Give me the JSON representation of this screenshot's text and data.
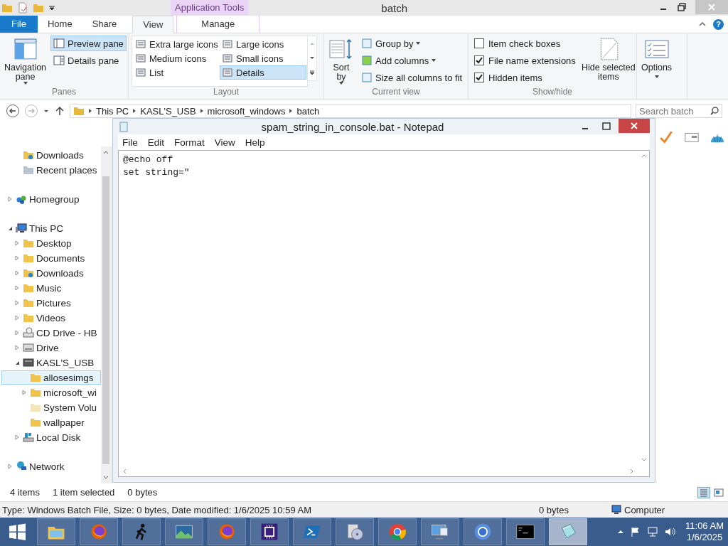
{
  "titlebar": {
    "title": "batch",
    "context_group": "Application Tools",
    "help": "?"
  },
  "ribbon_tabs": [
    {
      "label": "File",
      "kind": "file",
      "selected": false
    },
    {
      "label": "Home",
      "kind": "tab",
      "selected": false
    },
    {
      "label": "Share",
      "kind": "tab",
      "selected": false
    },
    {
      "label": "View",
      "kind": "tab",
      "selected": true
    },
    {
      "label": "Manage",
      "kind": "context",
      "selected": false
    }
  ],
  "ribbon": {
    "panes": {
      "title": "Panes",
      "navigation_pane": "Navigation pane",
      "items": [
        {
          "label": "Preview pane",
          "selected": true
        },
        {
          "label": "Details pane",
          "selected": false
        }
      ]
    },
    "layout": {
      "title": "Layout",
      "items": [
        {
          "label": "Extra large icons",
          "selected": false
        },
        {
          "label": "Large icons",
          "selected": false
        },
        {
          "label": "Medium icons",
          "selected": false
        },
        {
          "label": "Small icons",
          "selected": false
        },
        {
          "label": "List",
          "selected": false
        },
        {
          "label": "Details",
          "selected": true
        }
      ]
    },
    "current_view": {
      "title": "Current view",
      "sort_by": "Sort by",
      "items": [
        "Group by",
        "Add columns",
        "Size all columns to fit"
      ]
    },
    "show_hide": {
      "title": "Show/hide",
      "checkboxes": [
        {
          "label": "Item check boxes",
          "checked": false
        },
        {
          "label": "File name extensions",
          "checked": true
        },
        {
          "label": "Hidden items",
          "checked": true
        }
      ],
      "hide_selected": "Hide selected items"
    },
    "options": "Options"
  },
  "address_bar": {
    "breadcrumb": [
      "This PC",
      "KASL'S_USB",
      "microsoft_windows",
      "batch"
    ],
    "search": {
      "placeholder": "Search batch"
    }
  },
  "favorites": [
    {
      "label": "Downloads",
      "kind": "downloads",
      "selected": false
    },
    {
      "label": "Recent places",
      "kind": "recent",
      "selected": false
    }
  ],
  "tree": [
    {
      "label": "Homegroup",
      "kind": "homegroup",
      "expanded": false,
      "selected": false
    },
    {
      "label": "This PC",
      "kind": "pc",
      "expanded": true,
      "selected": false,
      "children": [
        {
          "label": "Desktop",
          "kind": "folder",
          "expanded": false,
          "selected": false
        },
        {
          "label": "Documents",
          "kind": "folder",
          "expanded": false,
          "selected": false
        },
        {
          "label": "Downloads",
          "kind": "downloads",
          "expanded": false,
          "selected": false
        },
        {
          "label": "Music",
          "kind": "folder",
          "expanded": false,
          "selected": false
        },
        {
          "label": "Pictures",
          "kind": "folder",
          "expanded": false,
          "selected": false
        },
        {
          "label": "Videos",
          "kind": "folder",
          "expanded": false,
          "selected": false
        },
        {
          "label": "CD Drive - HB",
          "kind": "cd",
          "expanded": false,
          "selected": false
        },
        {
          "label": "Drive",
          "kind": "drive",
          "expanded": false,
          "selected": false
        },
        {
          "label": "KASL'S_USB",
          "kind": "usb",
          "expanded": true,
          "selected": false,
          "children": [
            {
              "label": "allosesimgs",
              "kind": "folder",
              "selected": true
            },
            {
              "label": "microsoft_wi",
              "kind": "folder",
              "expanded": false,
              "selected": false
            },
            {
              "label": "System Volu",
              "kind": "faded",
              "selected": false
            },
            {
              "label": "wallpaper",
              "kind": "folder",
              "selected": false
            }
          ]
        },
        {
          "label": "Local Disk",
          "kind": "disk",
          "expanded": false,
          "selected": false
        }
      ]
    },
    {
      "label": "Network",
      "kind": "network",
      "expanded": false,
      "selected": false
    }
  ],
  "status_bar": {
    "item_count": "4 items",
    "selection": "1 item selected",
    "size": "0 bytes"
  },
  "details_bar": {
    "info": "Type: Windows Batch File, Size: 0 bytes, Date modified: 1/6/2025 10:59 AM",
    "size": "0 bytes",
    "location": "Computer"
  },
  "notepad": {
    "title": "spam_string_in_console.bat - Notepad",
    "menu": [
      "File",
      "Edit",
      "Format",
      "View",
      "Help"
    ],
    "lines": [
      "@echo off",
      "set string=\""
    ]
  },
  "taskbar": {
    "apps": [
      {
        "kind": "explorer",
        "selected": false
      },
      {
        "kind": "firefox",
        "selected": false
      },
      {
        "kind": "runner",
        "selected": false
      },
      {
        "kind": "photo",
        "selected": false
      },
      {
        "kind": "firefox",
        "selected": false
      },
      {
        "kind": "chip",
        "selected": false
      },
      {
        "kind": "powershell",
        "selected": false
      },
      {
        "kind": "installer",
        "selected": false
      },
      {
        "kind": "chrome",
        "selected": false
      },
      {
        "kind": "remote",
        "selected": false
      },
      {
        "kind": "chromium",
        "selected": false
      },
      {
        "kind": "terminal",
        "selected": false
      },
      {
        "kind": "notepad",
        "selected": true
      }
    ],
    "time": "11:06 AM",
    "date": "1/6/2025"
  }
}
